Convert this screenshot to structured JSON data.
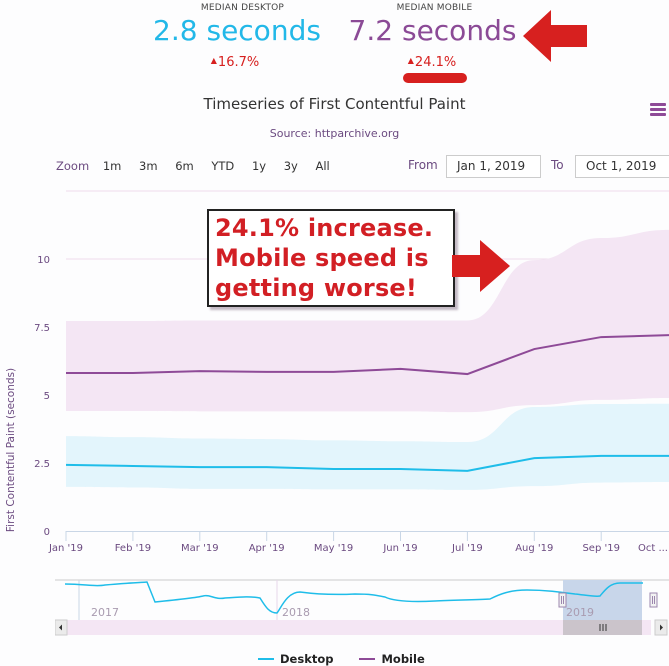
{
  "kpis": [
    {
      "label": "MEDIAN DESKTOP",
      "value": "2.8 seconds",
      "change": "16.7%",
      "direction": "up",
      "color": "#22b8e8"
    },
    {
      "label": "MEDIAN MOBILE",
      "value": "7.2 seconds",
      "change": "24.1%",
      "direction": "up",
      "color": "#8b4a96"
    }
  ],
  "colors": {
    "desktop": "#1fbde9",
    "mobile": "#8e4a97",
    "desktop_band": "#e3f5fc",
    "mobile_band": "#f4e6f4",
    "accent_red": "#d7201f",
    "axis_text": "#6b4a80"
  },
  "menu_icon": "hamburger-icon",
  "zoom": {
    "label": "Zoom",
    "buttons": [
      "1m",
      "3m",
      "6m",
      "YTD",
      "1y",
      "3y",
      "All"
    ]
  },
  "range": {
    "from_label": "From",
    "from_value": "Jan 1, 2019",
    "to_label": "To",
    "to_value": "Oct 1, 2019"
  },
  "annotation": {
    "lines": [
      "24.1% increase.",
      "Mobile speed is",
      "getting worse!"
    ]
  },
  "navigator": {
    "year_labels": [
      "2017",
      "2018",
      "2019"
    ],
    "scroll_left_icon": "arrow-left-icon",
    "scroll_right_icon": "arrow-right-icon",
    "grip_icon": "grip-icon"
  },
  "chart_data": {
    "type": "line",
    "title": "Timeseries of First Contentful Paint",
    "subtitle": "Source: httparchive.org",
    "xlabel": "",
    "ylabel": "First Contentful Paint (seconds)",
    "ylim": [
      0,
      12.5
    ],
    "yticks": [
      "0",
      "2.5",
      "5",
      "7.5",
      "10"
    ],
    "grid": true,
    "legend_position": "bottom",
    "categories": [
      "Jan '19",
      "Feb '19",
      "Mar '19",
      "Apr '19",
      "May '19",
      "Jun '19",
      "Jul '19",
      "Aug '19",
      "Sep '19",
      "Oct ..."
    ],
    "series": [
      {
        "name": "Desktop",
        "type": "line",
        "values": [
          2.43,
          2.39,
          2.35,
          2.35,
          2.28,
          2.28,
          2.21,
          2.68,
          2.76,
          2.76
        ],
        "band_low": [
          1.62,
          1.6,
          1.55,
          1.55,
          1.53,
          1.53,
          1.51,
          1.65,
          1.78,
          1.8
        ],
        "band_high": [
          3.49,
          3.45,
          3.4,
          3.38,
          3.33,
          3.3,
          3.27,
          4.56,
          4.67,
          4.68
        ]
      },
      {
        "name": "Mobile",
        "type": "line",
        "values": [
          5.81,
          5.81,
          5.88,
          5.85,
          5.85,
          5.96,
          5.77,
          6.69,
          7.13,
          7.2
        ],
        "band_low": [
          4.41,
          4.41,
          4.4,
          4.4,
          4.4,
          4.4,
          4.37,
          4.63,
          4.82,
          4.89
        ],
        "band_high": [
          7.72,
          7.72,
          7.74,
          7.74,
          7.74,
          7.74,
          7.74,
          9.96,
          10.77,
          11.07
        ]
      }
    ]
  }
}
